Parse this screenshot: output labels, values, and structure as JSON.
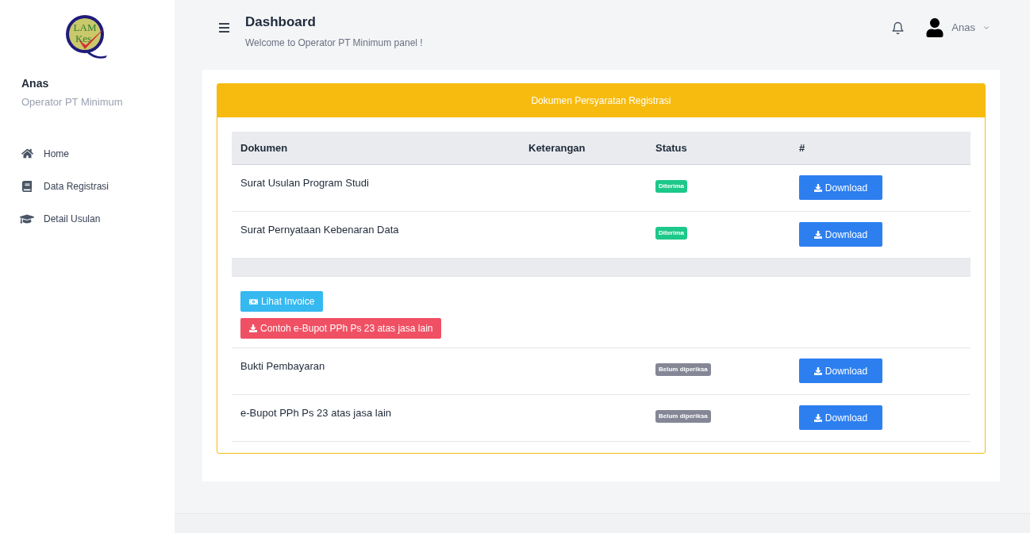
{
  "sidebar": {
    "logo": {
      "line1": "LAM",
      "line2": "Kes"
    },
    "user": {
      "name": "Anas",
      "role": "Operator PT Minimum"
    },
    "items": [
      {
        "label": "Home"
      },
      {
        "label": "Data Registrasi"
      },
      {
        "label": "Detail Usulan"
      }
    ]
  },
  "header": {
    "title": "Dashboard",
    "subtitle": "Welcome to Operator PT Minimum panel !",
    "user": "Anas"
  },
  "panel": {
    "title": "Dokumen Persyaratan Registrasi",
    "table": {
      "columns": [
        "Dokumen",
        "Keterangan",
        "Status",
        "#"
      ],
      "rows": [
        {
          "kind": "document",
          "name": "Surat Usulan Program Studi",
          "status": "Diterima",
          "color": "#1cc88a",
          "action": "Download"
        },
        {
          "kind": "document",
          "name": "Surat Pernyataan Kebenaran Data",
          "status": "Diterima",
          "color": "#1cc88a",
          "action": "Download"
        },
        {
          "kind": "separator"
        },
        {
          "kind": "actions",
          "buttons": [
            {
              "label": "Lihat Invoice",
              "kind": "invoice"
            },
            {
              "label": "Contoh e-Bupot PPh Ps 23 atas jasa lain",
              "kind": "download"
            }
          ]
        },
        {
          "kind": "document",
          "name": "Bukti Pembayaran",
          "status": "Belum diperiksa",
          "color": "#858796",
          "action": "Download"
        },
        {
          "kind": "document",
          "name": "e-Bupot PPh Ps 23 atas jasa lain",
          "status": "Belum diperiksa",
          "color": "#858796",
          "action": "Download"
        }
      ]
    }
  }
}
